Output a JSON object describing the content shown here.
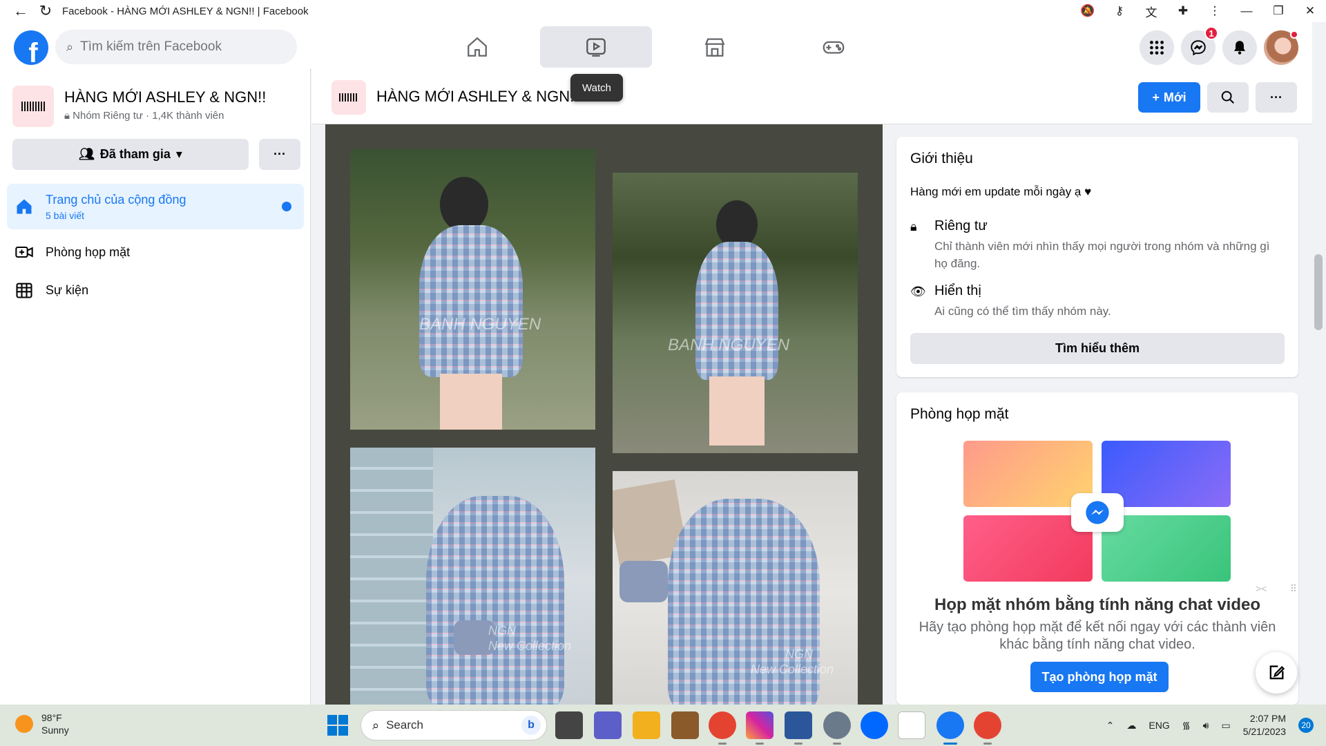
{
  "browser": {
    "title": "Facebook - HÀNG MỚI ASHLEY & NGN!! | Facebook"
  },
  "topbar": {
    "search_placeholder": "Tìm kiếm trên Facebook",
    "nav_tabs": [
      "home-icon",
      "watch-icon",
      "marketplace-icon",
      "gaming-icon"
    ],
    "active_tab": "Watch",
    "tooltip": "Watch",
    "messenger_badge": "1"
  },
  "sidebar": {
    "group_name": "HÀNG MỚI ASHLEY & NGN!!",
    "group_meta": "Nhóm Riêng tư · 1,4K thành viên",
    "joined_label": "Đã tham gia",
    "more_label": "···",
    "items": [
      {
        "label": "Trang chủ của cộng đồng",
        "sub": "5 bài viết",
        "icon": "home-icon"
      },
      {
        "label": "Phòng họp mặt",
        "icon": "video-room-icon"
      },
      {
        "label": "Sự kiện",
        "icon": "calendar-icon"
      }
    ]
  },
  "group_bar": {
    "name": "HÀNG MỚI ASHLEY & NGN!!",
    "new_label": "Mới",
    "more_label": "···"
  },
  "post": {
    "watermarks": [
      "BANH NGUYEN",
      "BANH NGUYEN",
      "NGN",
      "New Collection",
      "NGN",
      "New Collection"
    ]
  },
  "about": {
    "title": "Giới thiệu",
    "description": "Hàng mới em update mỗi ngày ạ ♥",
    "private_title": "Riêng tư",
    "private_desc": "Chỉ thành viên mới nhìn thấy mọi người trong nhóm và những gì họ đăng.",
    "visible_title": "Hiển thị",
    "visible_desc": "Ai cũng có thể tìm thấy nhóm này.",
    "learn_more": "Tìm hiểu thêm"
  },
  "room": {
    "title": "Phòng họp mặt",
    "headline": "Họp mặt nhóm bằng tính năng chat video",
    "desc": "Hãy tạo phòng họp mặt để kết nối ngay với các thành viên khác bằng tính năng chat video.",
    "create_label": "Tạo phòng họp mặt"
  },
  "taskbar": {
    "temp": "98°F",
    "condition": "Sunny",
    "search": "Search",
    "lang": "ENG",
    "time": "2:07 PM",
    "date": "5/21/2023",
    "notifications": "20"
  },
  "colors": {
    "brand": "#1877f2",
    "badge": "#e41e3f",
    "post_bg": "#47483f"
  }
}
